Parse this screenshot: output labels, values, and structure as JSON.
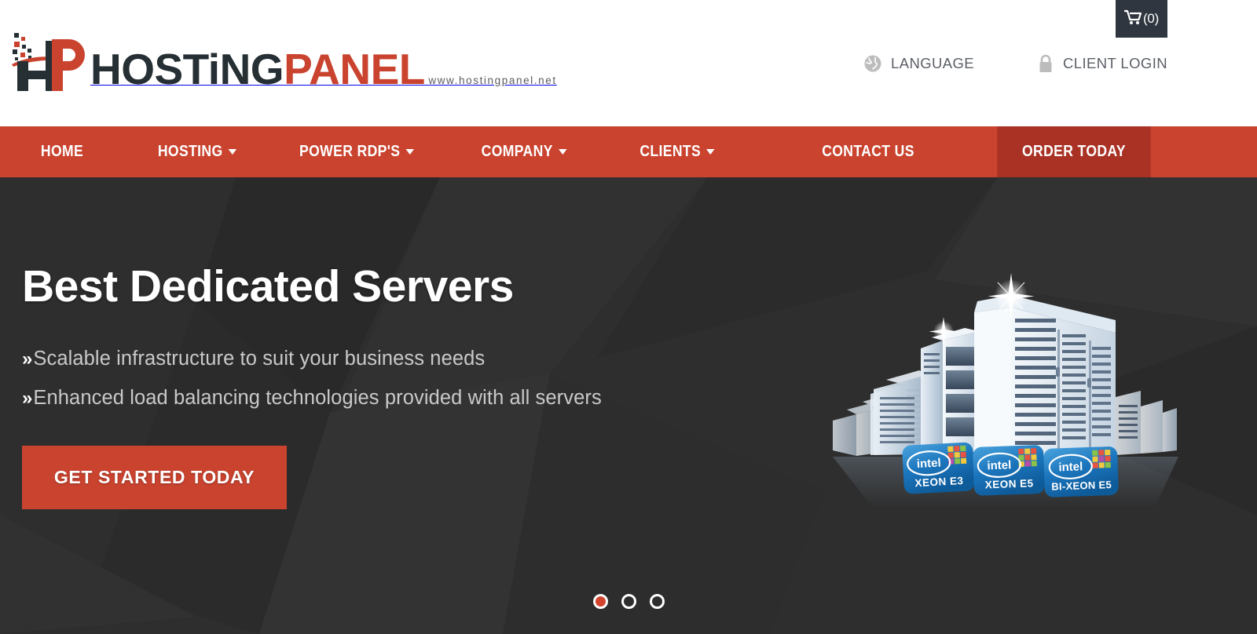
{
  "brand": {
    "name_part1": "HOSTiNG",
    "name_part2": "PANEL",
    "url": "www.hostingpanel.net",
    "logo_icon": "hp-monogram-icon",
    "accent_color": "#c9432f",
    "dark_color": "#262f33"
  },
  "header": {
    "utilities": [
      {
        "label": "LANGUAGE",
        "icon": "globe-icon"
      },
      {
        "label": "CLIENT LOGIN",
        "icon": "lock-icon"
      }
    ],
    "cart": {
      "icon": "shopping-cart-icon",
      "count_label": "(0)"
    }
  },
  "nav": {
    "background_color": "#c9432f",
    "active_color": "#a93225",
    "items": [
      {
        "label": "HOME",
        "has_dropdown": false
      },
      {
        "label": "HOSTING",
        "has_dropdown": true
      },
      {
        "label": "POWER RDP'S",
        "has_dropdown": true
      },
      {
        "label": "COMPANY",
        "has_dropdown": true
      },
      {
        "label": "CLIENTS",
        "has_dropdown": true
      },
      {
        "label": "CONTACT US",
        "has_dropdown": false
      },
      {
        "label": "ORDER TODAY",
        "has_dropdown": false,
        "highlight": true
      }
    ]
  },
  "hero": {
    "background_color": "#2e2e2e",
    "title": "Best Dedicated Servers",
    "bullet_marker": "»",
    "bullets": [
      "Scalable infrastructure to suit your business needs",
      "Enhanced load balancing technologies provided with all servers"
    ],
    "cta_label": "GET STARTED TODAY",
    "graphic": {
      "name": "server-racks-illustration",
      "badges": [
        {
          "brand": "intel",
          "model": "XEON E3"
        },
        {
          "brand": "intel",
          "model": "XEON E5"
        },
        {
          "brand": "intel",
          "model": "BI-XEON E5"
        }
      ]
    },
    "carousel": {
      "total": 3,
      "active_index": 0
    }
  }
}
